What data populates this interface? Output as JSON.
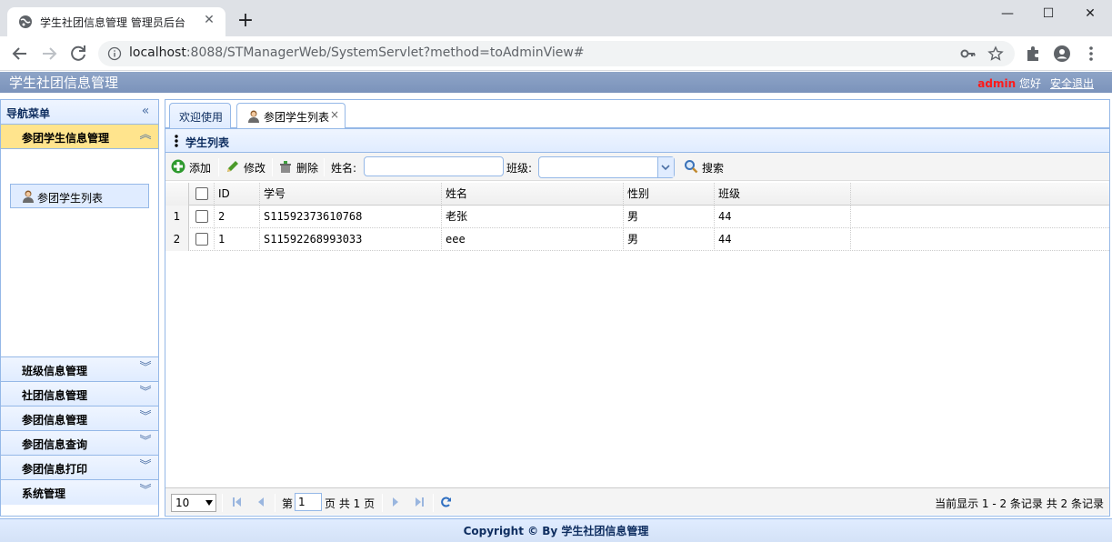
{
  "browser": {
    "tab_title": "学生社团信息管理 管理员后台",
    "url_host": "localhost",
    "url_rest": ":8088/STManagerWeb/SystemServlet?method=toAdminView#"
  },
  "app": {
    "title": "学生社团信息管理",
    "user_name": "admin",
    "greeting": " 您好",
    "logout": "安全退出"
  },
  "nav": {
    "title": "导航菜单",
    "sections": [
      {
        "label": "参团学生信息管理",
        "active": true
      },
      {
        "label": "班级信息管理"
      },
      {
        "label": "社团信息管理"
      },
      {
        "label": "参团信息管理"
      },
      {
        "label": "参团信息查询"
      },
      {
        "label": "参团信息打印"
      },
      {
        "label": "系统管理"
      }
    ],
    "active_link": "参团学生列表"
  },
  "tabs": [
    {
      "label": "欢迎使用"
    },
    {
      "label": "参团学生列表",
      "selected": true
    }
  ],
  "grid": {
    "title": "学生列表",
    "toolbar": {
      "add": "添加",
      "edit": "修改",
      "delete": "删除",
      "name_label": "姓名:",
      "class_label": "班级:",
      "search": "搜索"
    },
    "columns": [
      "ID",
      "学号",
      "姓名",
      "性别",
      "班级"
    ],
    "rows": [
      {
        "num": "1",
        "id": "2",
        "sn": "S11592373610768",
        "name": "老张",
        "sex": "男",
        "clazz": "44"
      },
      {
        "num": "2",
        "id": "1",
        "sn": "S11592268993033",
        "name": "eee",
        "sex": "男",
        "clazz": "44"
      }
    ],
    "pager": {
      "page_size": "10",
      "page_prefix": "第",
      "page_value": "1",
      "page_suffix": "页 共 1 页",
      "info": "当前显示 1 - 2 条记录 共 2 条记录"
    }
  },
  "footer": "Copyright © By 学生社团信息管理",
  "icons": {
    "favicon": "globe-icon",
    "info": "info-icon",
    "key": "key-icon",
    "star": "star-icon",
    "extensions": "puzzle-icon",
    "profile": "profile-icon",
    "menu": "kebab-icon"
  }
}
